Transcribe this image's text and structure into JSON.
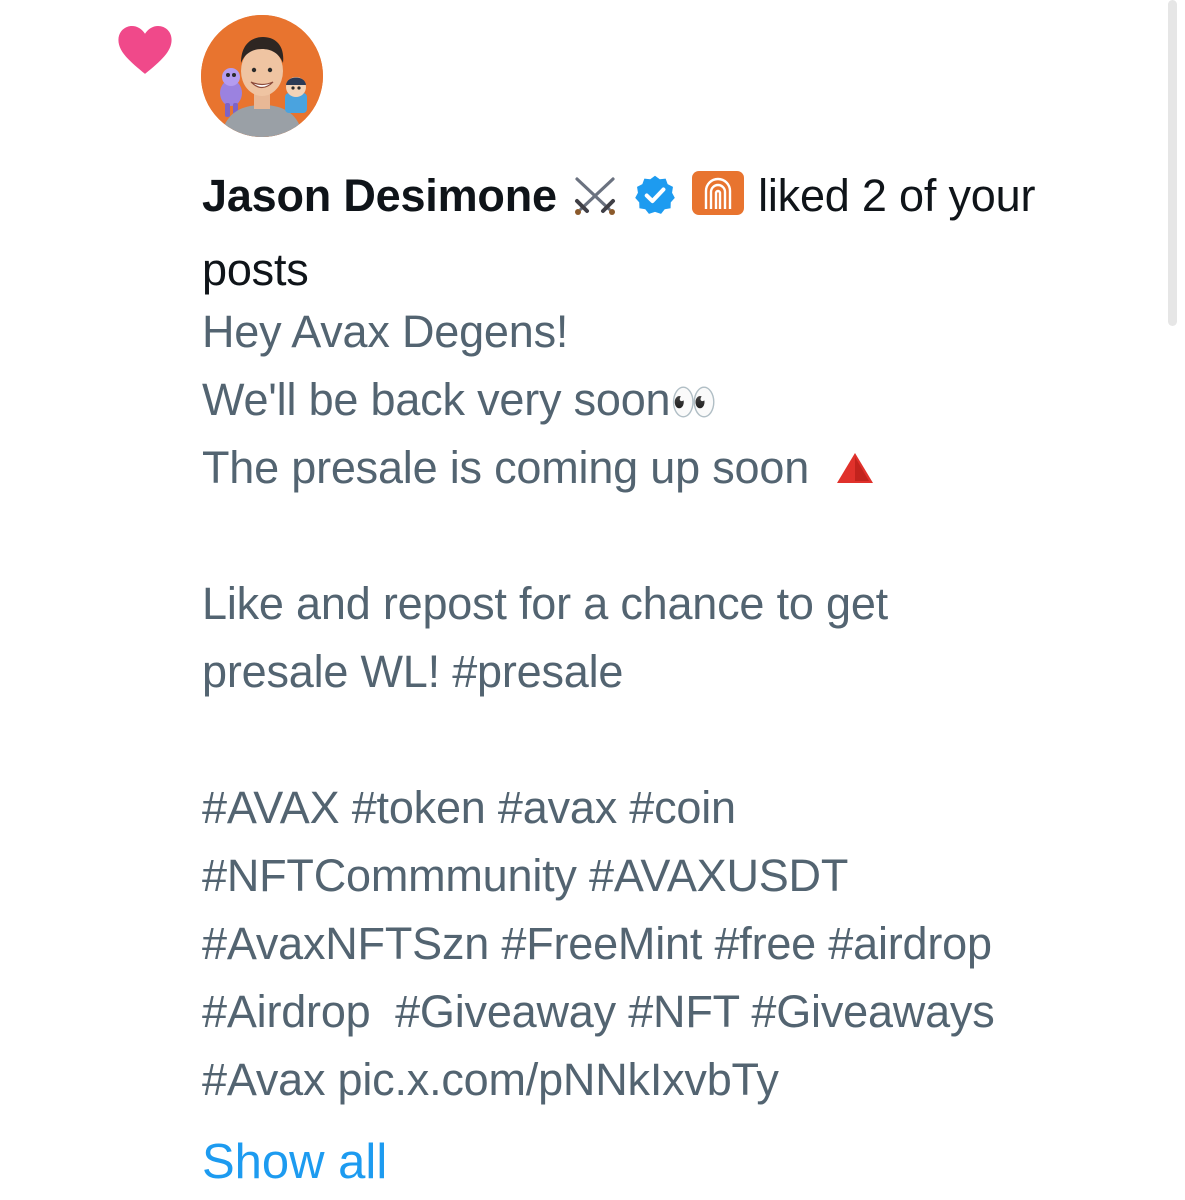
{
  "notification": {
    "type_icon": "heart-icon",
    "user_name": "Jason Desimone",
    "badges": [
      "crossed-swords-icon",
      "verified-badge-icon",
      "affiliate-badge-icon"
    ],
    "action_text": "liked 2 of your",
    "action_text_cont": "posts",
    "colors": {
      "heart": "#f91880",
      "verified": "#1d9bf0",
      "affiliate_badge": "#e8742f"
    }
  },
  "post": {
    "lines": [
      "Hey Avax Degens!",
      "We'll be back very soon",
      "The presale is coming up soon ",
      "",
      "Like and repost for a chance to get",
      "presale WL! #presale",
      "",
      "#AVAX #token #avax #coin",
      "#NFTCommmunity #AVAXUSDT",
      "#AvaxNFTSzn #FreeMint #free #airdrop",
      "#Airdrop  #Giveaway #NFT #Giveaways",
      "#Avax pic.x.com/pNNkIxvbTy"
    ],
    "emoji": {
      "eyes": "👀",
      "red_triangle": "🔺"
    }
  },
  "show_all_label": "Show all",
  "colors": {
    "primary_text": "#0f1419",
    "secondary_text": "#536471",
    "link": "#1d9bf0"
  }
}
